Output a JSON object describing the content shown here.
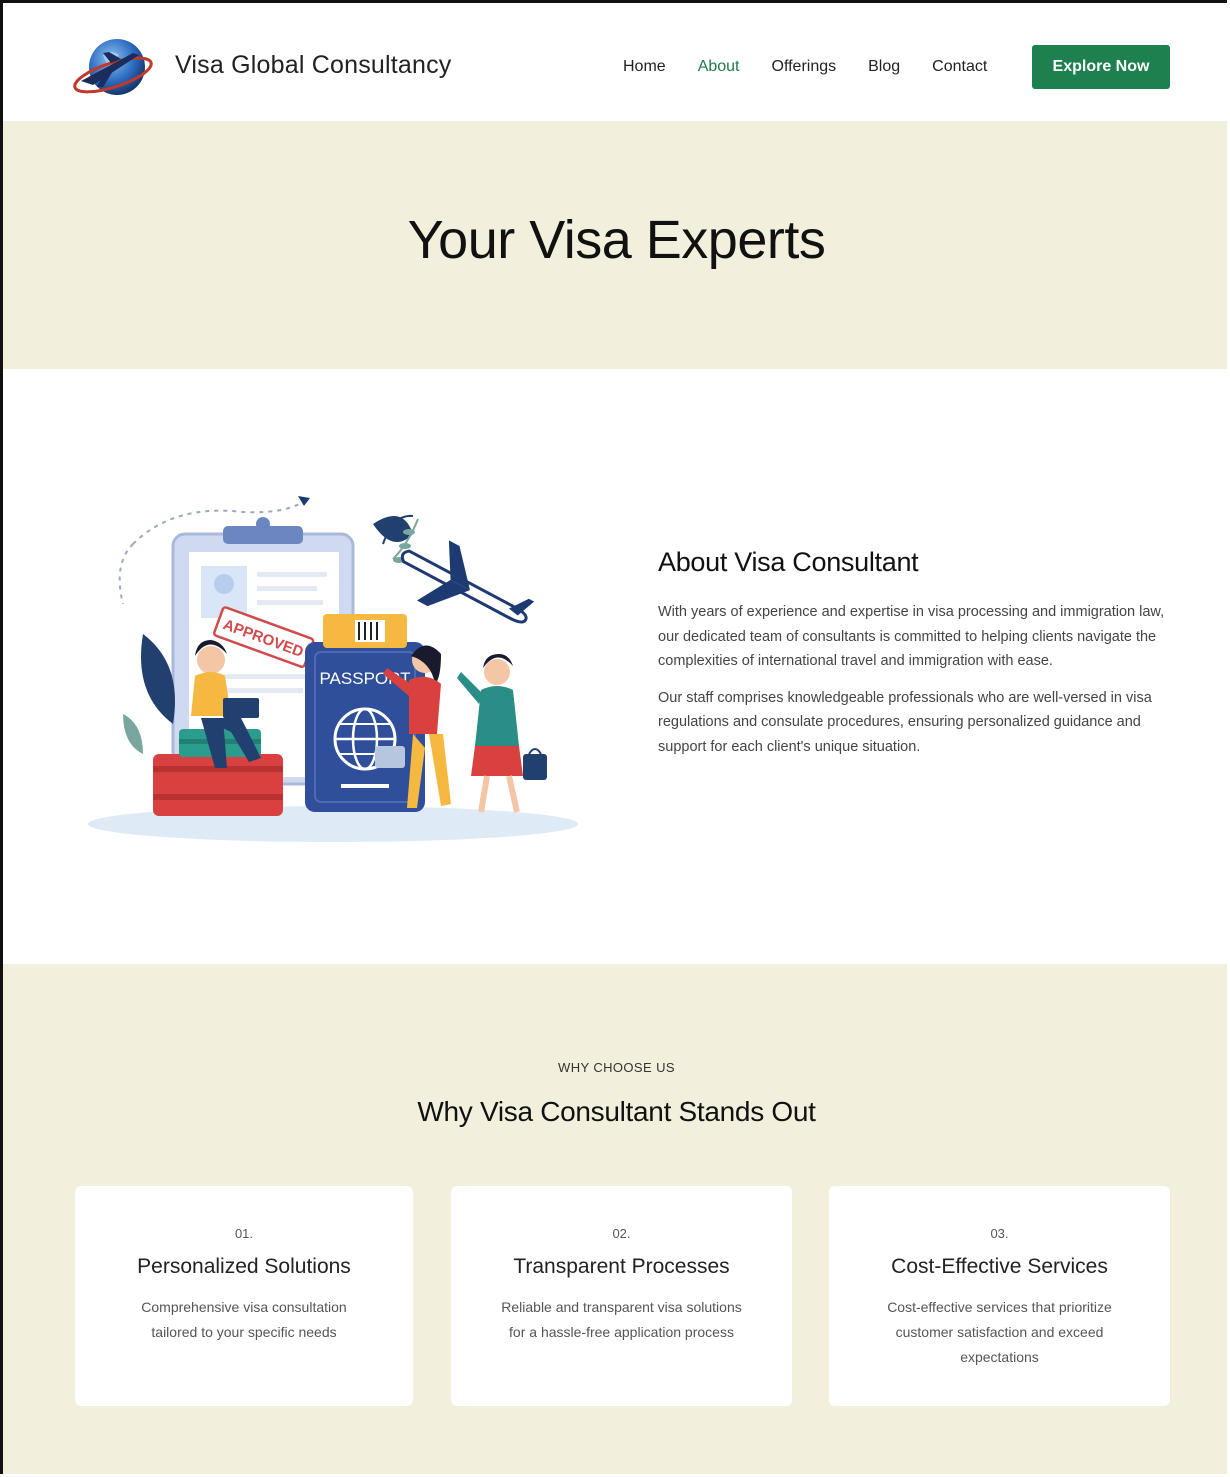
{
  "header": {
    "brand": "Visa Global Consultancy",
    "nav": [
      "Home",
      "About",
      "Offerings",
      "Blog",
      "Contact"
    ],
    "active_nav": "About",
    "cta": "Explore Now"
  },
  "hero": {
    "title": "Your Visa Experts"
  },
  "about": {
    "title": "About Visa Consultant",
    "paragraphs": [
      "With years of experience and expertise in visa processing and immigration law, our dedicated team of consultants is committed to helping clients navigate the complexities of international travel and immigration with ease.",
      "Our staff comprises knowledgeable professionals who are well-versed in visa regulations and consulate procedures, ensuring personalized guidance and support for each client's unique situation."
    ],
    "illustration": {
      "approved_stamp": "APPROVED",
      "passport_label": "PASSPORT"
    }
  },
  "why": {
    "eyebrow": "WHY CHOOSE US",
    "title": "Why Visa Consultant Stands Out",
    "cards": [
      {
        "num": "01.",
        "title": "Personalized Solutions",
        "text": "Comprehensive visa consultation tailored to your specific needs"
      },
      {
        "num": "02.",
        "title": "Transparent Processes",
        "text": "Reliable and transparent visa solutions for a hassle-free application process"
      },
      {
        "num": "03.",
        "title": "Cost-Effective Services",
        "text": "Cost-effective services that prioritize customer satisfaction and exceed expectations"
      }
    ]
  },
  "colors": {
    "accent": "#1e7f4f",
    "section_bg": "#f2f0dc",
    "passport": "#2f4f9a",
    "stamp": "#d24a4a"
  }
}
